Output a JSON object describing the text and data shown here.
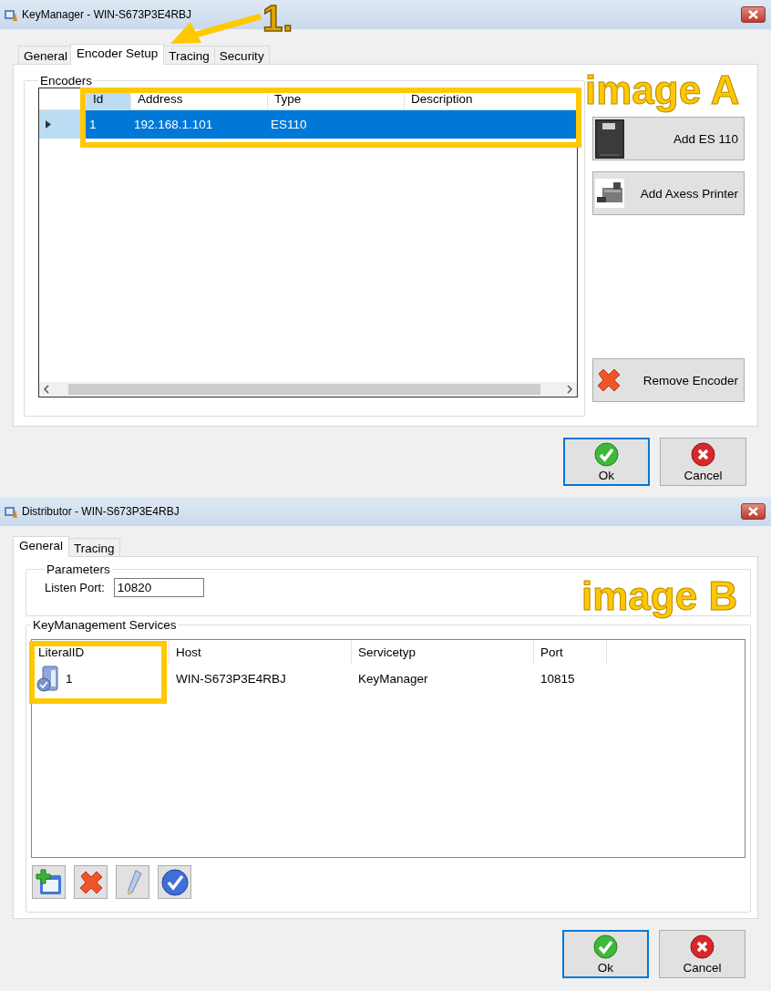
{
  "key_manager": {
    "title": "KeyManager - WIN-S673P3E4RBJ",
    "tabs": [
      {
        "label": "General",
        "selected": false
      },
      {
        "label": "Encoder Setup",
        "selected": true
      },
      {
        "label": "Tracing",
        "selected": false
      },
      {
        "label": "Security",
        "selected": false
      }
    ],
    "group_title": "Encoders",
    "grid": {
      "columns": [
        {
          "label": "Id",
          "selected": true
        },
        {
          "label": "Address",
          "selected": false
        },
        {
          "label": "Type",
          "selected": false
        },
        {
          "label": "Description",
          "selected": false
        }
      ],
      "rows": [
        {
          "cells": [
            "1",
            "192.168.1.101",
            "ES110"
          ],
          "selected": true
        }
      ]
    },
    "side_buttons": [
      {
        "kind": "encoder",
        "label": "Add ES 110"
      },
      {
        "kind": "printer",
        "label": "Add Axess Printer"
      },
      {
        "kind": "remove",
        "label": "Remove Encoder"
      }
    ],
    "buttons": [
      {
        "kind": "ok",
        "label": "Ok",
        "focused": true
      },
      {
        "kind": "cancel",
        "label": "Cancel",
        "focused": false
      }
    ],
    "annotations": [
      {
        "kind": "highlight"
      },
      {
        "kind": "arrow",
        "text": "1."
      },
      {
        "kind": "label",
        "text": "image A"
      }
    ]
  },
  "distributor": {
    "title": "Distributor - WIN-S673P3E4RBJ",
    "tabs": [
      {
        "label": "General",
        "selected": true
      },
      {
        "label": "Tracing",
        "selected": false
      }
    ],
    "parameters": {
      "title": "Parameters",
      "label": "Listen Port:",
      "value": "10820"
    },
    "services": {
      "title": "KeyManagement Services",
      "columns": [
        "LiteralID",
        "Host",
        "Servicetyp",
        "Port"
      ],
      "rows": [
        {
          "cells": [
            "1",
            "WIN-S673P3E4RBJ",
            "KeyManager",
            "10815"
          ]
        }
      ]
    },
    "toolbar": [
      {
        "kind": "add"
      },
      {
        "kind": "delete"
      },
      {
        "kind": "edit"
      },
      {
        "kind": "apply"
      }
    ],
    "buttons": [
      {
        "kind": "ok",
        "label": "Ok",
        "focused": true
      },
      {
        "kind": "cancel",
        "label": "Cancel",
        "focused": false
      }
    ],
    "annotations": [
      {
        "kind": "highlight"
      },
      {
        "kind": "label",
        "text": "image B"
      }
    ]
  }
}
